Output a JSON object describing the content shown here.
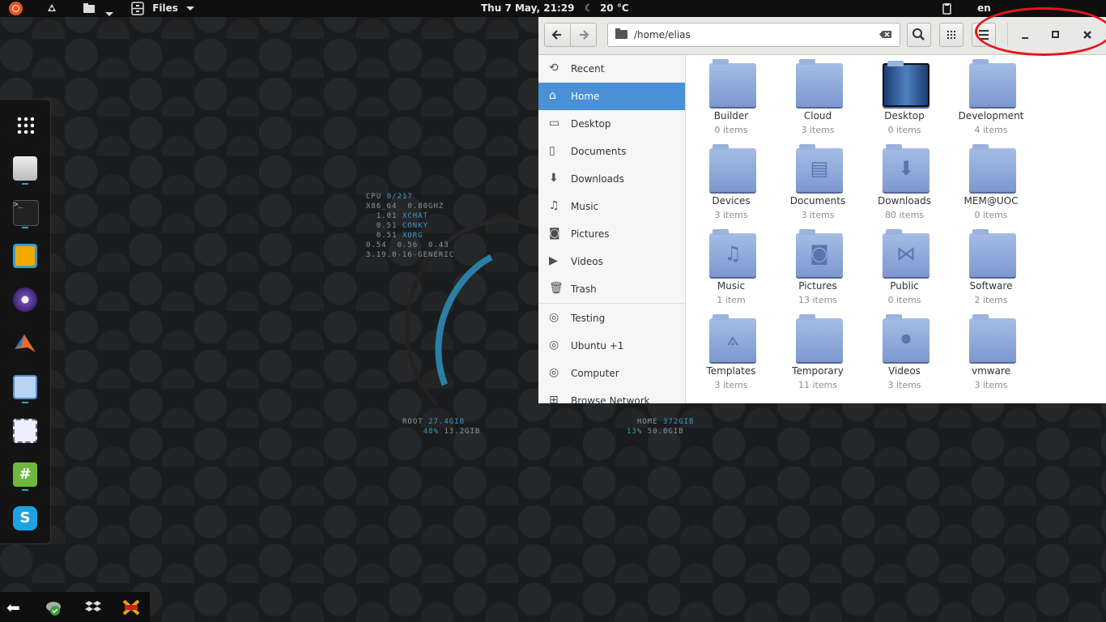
{
  "topbar": {
    "menu_label": "Files",
    "datetime": "Thu  7 May, 21:29",
    "weather": "20 °C",
    "language": "en"
  },
  "conky": {
    "cpu_label": "CPU",
    "cpu_value": "0/217",
    "arch": "X86_64",
    "freq": "0.80GHZ",
    "proc1_val": "1.01",
    "proc1_name": "XCHAT",
    "proc2_val": "0.51",
    "proc2_name": "CONKY",
    "proc3_val": "0.51",
    "proc3_name": "XORG",
    "load": "0.54  0.56  0.43",
    "kernel": "3.19.0-16-GENERIC",
    "root_label": "ROOT",
    "root_size": "27.4GIB",
    "root_pct": "48%",
    "root_used": "13.2GIB",
    "home_label": "HOME",
    "home_size": "372GIB",
    "home_pct": "13%",
    "home_used": "50.0GIB"
  },
  "files": {
    "path": "/home/elias",
    "sidebar": [
      {
        "label": "Recent",
        "icon": "clock-icon"
      },
      {
        "label": "Home",
        "icon": "home-icon",
        "selected": true
      },
      {
        "label": "Desktop",
        "icon": "desktop-icon"
      },
      {
        "label": "Documents",
        "icon": "document-icon"
      },
      {
        "label": "Downloads",
        "icon": "download-icon"
      },
      {
        "label": "Music",
        "icon": "music-icon"
      },
      {
        "label": "Pictures",
        "icon": "camera-icon"
      },
      {
        "label": "Videos",
        "icon": "video-icon"
      },
      {
        "label": "Trash",
        "icon": "trash-icon"
      },
      {
        "label": "Testing",
        "icon": "disk-icon"
      },
      {
        "label": "Ubuntu +1",
        "icon": "disk-icon"
      },
      {
        "label": "Computer",
        "icon": "disk-icon"
      },
      {
        "label": "Browse Network",
        "icon": "network-icon"
      }
    ],
    "items": [
      {
        "name": "Builder",
        "count": "0 items",
        "icon": "folder-icon"
      },
      {
        "name": "Cloud",
        "count": "3 items",
        "icon": "folder-icon"
      },
      {
        "name": "Desktop",
        "count": "0 items",
        "icon": "desktop-folder-icon"
      },
      {
        "name": "Development",
        "count": "4 items",
        "icon": "folder-icon"
      },
      {
        "name": "Devices",
        "count": "3 items",
        "icon": "folder-icon"
      },
      {
        "name": "Documents",
        "count": "3 items",
        "icon": "documents-folder-icon"
      },
      {
        "name": "Downloads",
        "count": "80 items",
        "icon": "downloads-folder-icon"
      },
      {
        "name": "MEM@UOC",
        "count": "0 items",
        "icon": "folder-icon"
      },
      {
        "name": "Music",
        "count": "1 item",
        "icon": "music-folder-icon"
      },
      {
        "name": "Pictures",
        "count": "13 items",
        "icon": "pictures-folder-icon"
      },
      {
        "name": "Public",
        "count": "0 items",
        "icon": "public-folder-icon"
      },
      {
        "name": "Software",
        "count": "2 items",
        "icon": "folder-icon"
      },
      {
        "name": "Templates",
        "count": "3 items",
        "icon": "templates-folder-icon"
      },
      {
        "name": "Temporary",
        "count": "11 items",
        "icon": "folder-icon"
      },
      {
        "name": "Videos",
        "count": "3 items",
        "icon": "videos-folder-icon"
      },
      {
        "name": "vmware",
        "count": "3 items",
        "icon": "folder-icon"
      }
    ]
  },
  "colors": {
    "accent": "#4a90d9",
    "annotation": "#e6151b",
    "desktop_glow": "#3a9ecb"
  }
}
